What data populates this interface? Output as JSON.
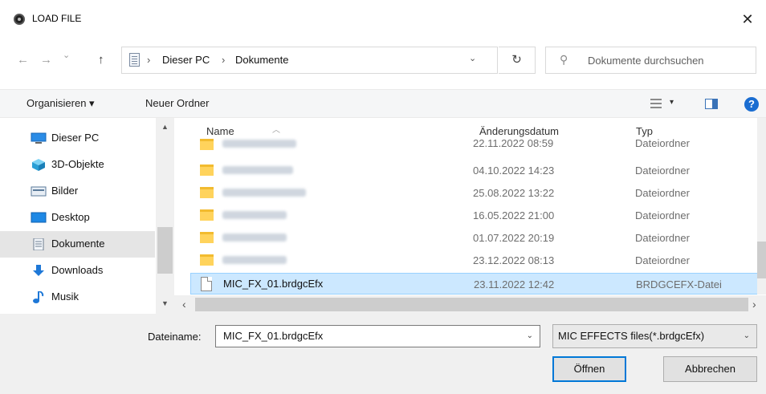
{
  "window": {
    "title": "LOAD FILE",
    "close_glyph": "✕",
    "app_icon": "record-icon"
  },
  "nav": {
    "back_glyph": "←",
    "forward_glyph": "→",
    "recent_glyph": "⌄",
    "up_glyph": "↑"
  },
  "address": {
    "icon": "documents-icon",
    "separator": "›",
    "crumbs": [
      "Dieser PC",
      "Dokumente"
    ],
    "dropdown_glyph": "⌄",
    "refresh_glyph": "↻"
  },
  "search": {
    "icon": "search-icon",
    "glyph": "⚲",
    "placeholder": "Dokumente durchsuchen"
  },
  "toolbar": {
    "organize": "Organisieren ▾",
    "new_folder": "Neuer Ordner",
    "view_dropdown": "▾",
    "help": "?"
  },
  "sidebar": {
    "items": [
      {
        "label": "Dieser PC",
        "icon": "this-pc-icon"
      },
      {
        "label": "3D-Objekte",
        "icon": "3d-objects-icon"
      },
      {
        "label": "Bilder",
        "icon": "pictures-icon"
      },
      {
        "label": "Desktop",
        "icon": "desktop-icon"
      },
      {
        "label": "Dokumente",
        "icon": "documents-icon",
        "selected": true
      },
      {
        "label": "Downloads",
        "icon": "downloads-icon"
      },
      {
        "label": "Musik",
        "icon": "music-icon"
      }
    ],
    "scroll_up": "▲",
    "scroll_down": "▼"
  },
  "columns": {
    "name": "Name",
    "date": "Änderungsdatum",
    "type": "Typ",
    "sort_caret": "︿"
  },
  "rows": [
    {
      "date": "22.11.2022 08:59",
      "type": "Dateiordner",
      "kind": "folder"
    },
    {
      "date": "04.10.2022 14:23",
      "type": "Dateiordner",
      "kind": "folder"
    },
    {
      "date": "25.08.2022 13:22",
      "type": "Dateiordner",
      "kind": "folder"
    },
    {
      "date": "16.05.2022 21:00",
      "type": "Dateiordner",
      "kind": "folder"
    },
    {
      "date": "01.07.2022 20:19",
      "type": "Dateiordner",
      "kind": "folder"
    },
    {
      "date": "23.12.2022 08:13",
      "type": "Dateiordner",
      "kind": "folder"
    },
    {
      "name": "MIC_FX_01.brdgcEfx",
      "date": "23.11.2022 12:42",
      "type": "BRDGCEFX-Datei",
      "kind": "file",
      "selected": true
    }
  ],
  "hscroll": {
    "left": "‹",
    "right": "›"
  },
  "filename": {
    "label": "Dateiname:",
    "value": "MIC_FX_01.brdgcEfx",
    "dropdown_glyph": "⌄"
  },
  "filter": {
    "value": "MIC EFFECTS files(*.brdgcEfx)",
    "dropdown_glyph": "⌄"
  },
  "buttons": {
    "open": "Öffnen",
    "cancel": "Abbrechen"
  }
}
